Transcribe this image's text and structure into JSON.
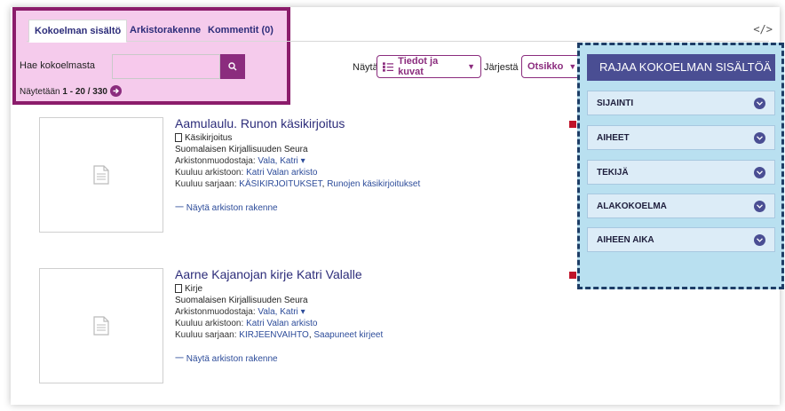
{
  "tabs": {
    "contents": "Kokoelman sisältö",
    "structure": "Arkistorakenne",
    "comments": "Kommentit (0)"
  },
  "embed_icon": "</>",
  "search": {
    "label": "Hae kokoelmasta",
    "value": "",
    "placeholder": ""
  },
  "showing": {
    "prefix": "Näytetään ",
    "range": "1 - 20 / 330"
  },
  "view": {
    "show_label": "Näytä",
    "view_mode": "Tiedot ja kuvat",
    "sort_label": "Järjestä",
    "sort_value": "Otsikko"
  },
  "results": [
    {
      "title": "Aamulaulu. Runon käsikirjoitus",
      "format": "Käsikirjoitus",
      "organisation": "Suomalaisen Kirjallisuuden Seura",
      "creator_label": "Arkistonmuodostaja: ",
      "creator": "Vala, Katri",
      "archive_label": "Kuuluu arkistoon: ",
      "archive": "Katri Valan arkisto",
      "series_label": "Kuuluu sarjaan: ",
      "series_a": "KÄSIKIRJOITUKSET",
      "series_b": "Runojen käsikirjoitukset",
      "tree": "Näytä arkiston rakenne"
    },
    {
      "title": "Aarne Kajanojan kirje Katri Valalle",
      "format": "Kirje",
      "organisation": "Suomalaisen Kirjallisuuden Seura",
      "creator_label": "Arkistonmuodostaja: ",
      "creator": "Vala, Katri",
      "archive_label": "Kuuluu arkistoon: ",
      "archive": "Katri Valan arkisto",
      "series_label": "Kuuluu sarjaan: ",
      "series_a": "KIRJEENVAIHTO",
      "series_b": "Saapuneet kirjeet",
      "tree": "Näytä arkiston rakenne"
    }
  ],
  "filters": {
    "title": "RAJAA KOKOELMAN SISÄLTÖÄ",
    "facets": [
      "SIJAINTI",
      "AIHEET",
      "TEKIJÄ",
      "ALAKOKOELMA",
      "AIHEEN AIKA"
    ]
  },
  "colors": {
    "accent": "#8b2c7e",
    "link": "#2d2d7a",
    "panel_header": "#4a4e93",
    "panel_bg": "#b9e0f0",
    "search_highlight": "#ec9fdc"
  }
}
